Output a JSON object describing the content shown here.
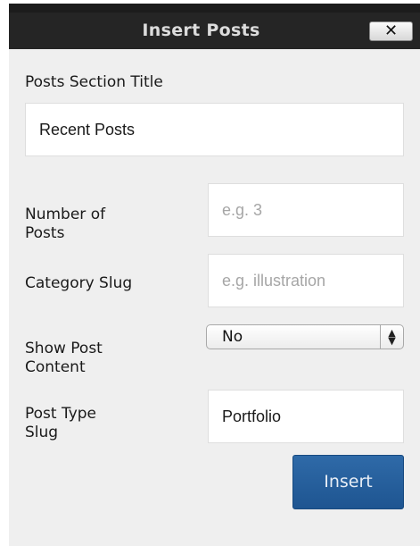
{
  "dialog": {
    "title": "Insert Posts",
    "close_label": "✕"
  },
  "form": {
    "section_title": {
      "label": "Posts Section Title",
      "value": "Recent Posts"
    },
    "number_of_posts": {
      "label_line1": "Number of",
      "label_line2": "Posts",
      "placeholder": "e.g. 3"
    },
    "category_slug": {
      "label": "Category Slug",
      "placeholder": "e.g. illustration"
    },
    "show_post_content": {
      "label_line1": "Show Post",
      "label_line2": "Content",
      "selected": "No"
    },
    "post_type_slug": {
      "label_line1": "Post Type",
      "label_line2": "Slug",
      "value": "Portfolio"
    }
  },
  "actions": {
    "insert_label": "Insert"
  }
}
